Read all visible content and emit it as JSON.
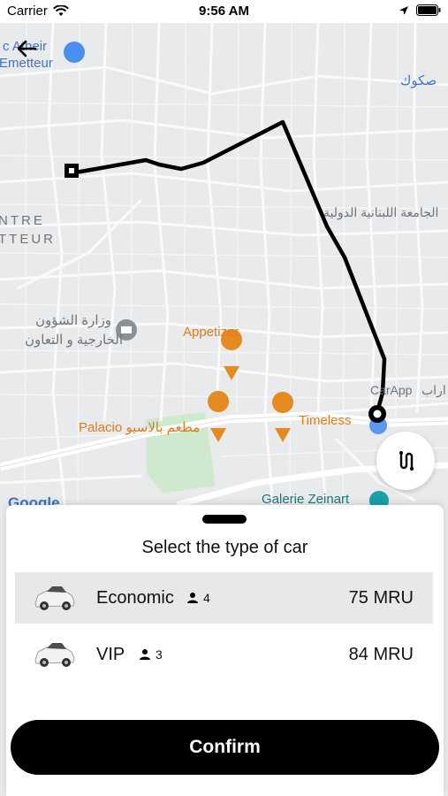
{
  "status_bar": {
    "carrier": "Carrier",
    "time": "9:56 AM"
  },
  "map": {
    "labels": {
      "top_left_1": "c Atheir",
      "top_left_2": "Emetteur",
      "top_right": "صكوك",
      "centre_1": "NTRE",
      "centre_2": "TTEUR",
      "lebanese_univ": "الجامعة اللبنانية الدولية",
      "ministry_1": "وزارة الشؤون",
      "ministry_2": "الخارجية و التعاون",
      "appetizer": "Appetizer",
      "carapp": "CarApp",
      "carapp_ar": "اراب",
      "palacio": "Palacio مطعم بالاسيو",
      "timeless": "Timeless",
      "galerie": "Galerie Zeinart",
      "google": "Google"
    }
  },
  "sheet": {
    "title": "Select the type of car",
    "cars": [
      {
        "name": "Economic",
        "seats": "4",
        "price": "75 MRU",
        "selected": true
      },
      {
        "name": "VIP",
        "seats": "3",
        "price": "84 MRU",
        "selected": false
      }
    ],
    "confirm_label": "Confirm"
  },
  "icons": {
    "back": "arrow-left-icon",
    "swap": "swap-route-icon",
    "person": "person-icon",
    "wifi": "wifi-icon",
    "location": "location-arrow-icon",
    "battery": "battery-icon"
  },
  "colors": {
    "route": "#000000",
    "accent_blue": "#3f73c6",
    "poi_orange": "#e58a20"
  }
}
